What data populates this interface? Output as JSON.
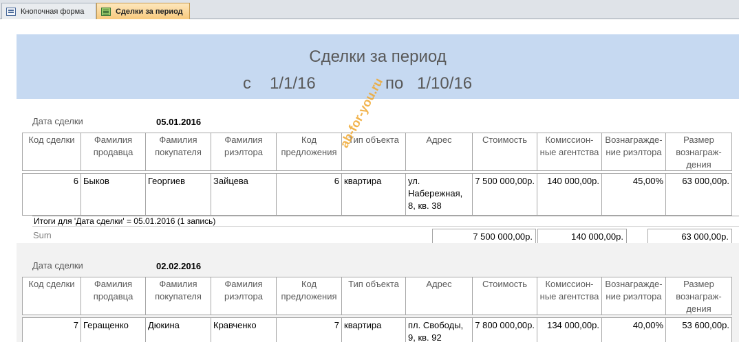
{
  "tabs": [
    {
      "label": "Кнопочная форма",
      "icon": "form-icon"
    },
    {
      "label": "Сделки за период",
      "icon": "report-icon"
    }
  ],
  "report": {
    "title": "Сделки за период",
    "from_label": "с",
    "from_value": "1/1/16",
    "to_label": "по",
    "to_value": "1/10/16",
    "columns": [
      "Код сделки",
      "Фамилия\nпродавца",
      "Фамилия\nпокупателя",
      "Фамилия\nриэлтора",
      "Код\nпредложения",
      "Тип объекта",
      "Адрес",
      "Стоимость",
      "Комиссион-\nные агентства",
      "Вознагражде-\nние риэлтора",
      "Размер\nвознаграж-\nдения"
    ],
    "groups": [
      {
        "date_label": "Дата сделки",
        "date_value": "05.01.2016",
        "row": [
          "6",
          "Быков",
          "Георгиев",
          "Зайцева",
          "6",
          "квартира",
          "ул.\nНабережная,\n8, кв. 38",
          "7 500 000,00р.",
          "140 000,00р.",
          "45,00%",
          "63 000,00р."
        ],
        "summary": "Итоги для 'Дата сделки' =  05.01.2016 (1 запись)",
        "sum_label": "Sum",
        "sum_cost": "7 500 000,00р.",
        "sum_commission": "140 000,00р.",
        "sum_reward": "63 000,00р."
      },
      {
        "date_label": "Дата сделки",
        "date_value": "02.02.2016",
        "row": [
          "7",
          "Геращенко",
          "Дюкина",
          "Кравченко",
          "7",
          "квартира",
          "пл. Свободы,\n9, кв. 92",
          "7 800 000,00р.",
          "134 000,00р.",
          "40,00%",
          "53 600,00р."
        ]
      }
    ],
    "watermark": "ab-for-you.ru"
  }
}
